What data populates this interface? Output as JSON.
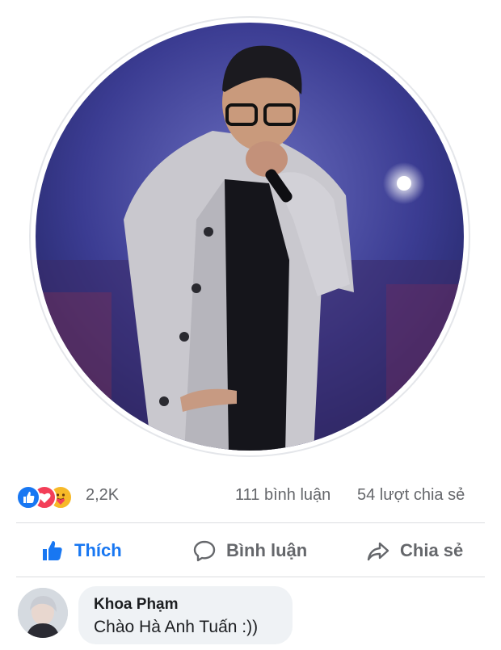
{
  "post": {
    "stats": {
      "reaction_count": "2,2K",
      "comments": "111 bình luận",
      "shares": "54 lượt chia sẻ",
      "reactions": [
        "like",
        "love",
        "care"
      ]
    },
    "actions": {
      "like_label": "Thích",
      "comment_label": "Bình luận",
      "share_label": "Chia sẻ"
    },
    "comment": {
      "author": "Khoa Phạm",
      "text": "Chào Hà Anh Tuấn :))"
    }
  },
  "colors": {
    "like_blue": "#1877f2",
    "love_red": "#f33e58",
    "care_yellow": "#f7b928",
    "muted_text": "#65676b",
    "bubble_bg": "#eff2f5"
  }
}
